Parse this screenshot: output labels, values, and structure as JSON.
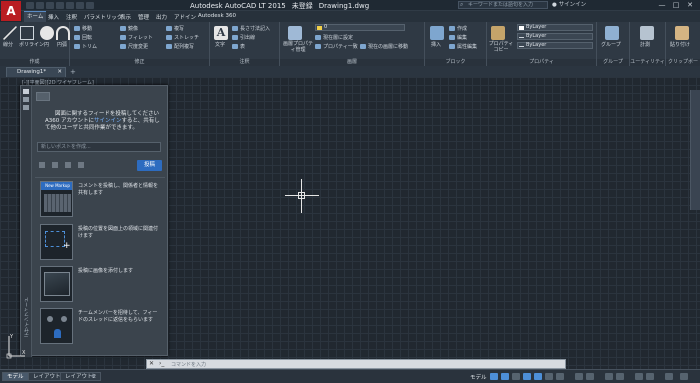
{
  "app": {
    "logo": "A",
    "title_parts": [
      "Autodesk AutoCAD LT 2015",
      "未登録",
      "Drawing1.dwg"
    ],
    "search_placeholder": "キーワードまたは語句を入力",
    "user_label": "サインイン",
    "window_buttons": [
      "—",
      "□",
      "✕"
    ]
  },
  "menu": [
    {
      "label": "ホーム"
    },
    {
      "label": "挿入"
    },
    {
      "label": "注釈"
    },
    {
      "label": "パラメトリック"
    },
    {
      "label": "表示"
    },
    {
      "label": "管理"
    },
    {
      "label": "出力"
    },
    {
      "label": "アドイン"
    },
    {
      "label": "Autodesk 360"
    }
  ],
  "ribbon": {
    "draw": {
      "label": "作成",
      "line": "線分",
      "polyline": "ポリライン",
      "circle": "円",
      "arc": "円弧"
    },
    "modify": {
      "label": "修正",
      "items": [
        "移動",
        "回転",
        "トリム",
        "鏡像",
        "フィレット",
        "尺度変更",
        "複写",
        "ストレッチ",
        "配列複写"
      ]
    },
    "annotation": {
      "label": "注釈",
      "text": "文字",
      "items": [
        "長さ寸法記入",
        "引出線",
        "表"
      ]
    },
    "layers": {
      "label": "画層",
      "properties": "画層プロパティ管理",
      "current": "0",
      "items": [
        "現在層に設定",
        "プロパティ一致",
        "現在の画層に移動"
      ]
    },
    "block": {
      "label": "ブロック",
      "insert": "挿入",
      "items": [
        "作成",
        "編集",
        "属性編集"
      ]
    },
    "properties": {
      "label": "プロパティ",
      "match": "プロパティコピー",
      "bylayer": "ByLayer"
    },
    "groups": {
      "label": "グループ",
      "group": "グループ"
    },
    "utilities": {
      "label": "ユーティリティ",
      "measure": "計測"
    },
    "clipboard": {
      "label": "クリップボード",
      "paste": "貼り付け"
    }
  },
  "doc_tab": {
    "label": "Drawing1*",
    "close": "✕",
    "new": "+"
  },
  "viewport_label": "[-][平面図][2D ワイヤフレーム]",
  "design_feed": {
    "strip_label": "デザインフィード",
    "intro_title": "図面に関するフィードを投稿してください",
    "intro_body_prefix": "A360 アカウントに",
    "intro_link": "サインイン",
    "intro_body_suffix": "すると、共有して他のユーザと共同作業ができます。",
    "input_placeholder": "新しいポストを作成...",
    "post_button": "投稿",
    "cards": [
      {
        "thumb_caption": "New Markup",
        "text": "コメントを投稿し、関係者と情報を共有します"
      },
      {
        "thumb_caption": "",
        "text": "投稿の位置を図面上の領域に関連付けます"
      },
      {
        "thumb_caption": "",
        "text": "投稿に画像を添付します"
      },
      {
        "thumb_caption": "",
        "text": "チームメンバーを招待して、フィードのスレッドに返信をもらいます"
      }
    ]
  },
  "command_line": {
    "placeholder": "コマンドを入力"
  },
  "status_bar": {
    "layouts": [
      {
        "label": "モデル"
      },
      {
        "label": "レイアウト1"
      },
      {
        "label": "レイアウト2"
      }
    ],
    "add_layout": "+",
    "space": "モデル"
  },
  "ucs": {
    "x": "X",
    "y": "Y"
  },
  "colors": {
    "accent": "#2d6cc0",
    "logo_red": "#b91d22",
    "canvas": "#212830"
  }
}
